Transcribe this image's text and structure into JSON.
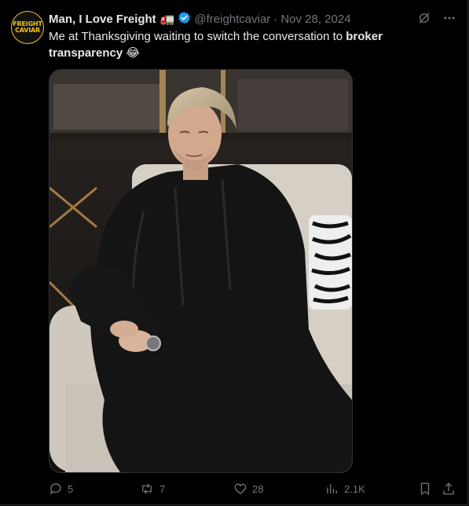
{
  "tweet": {
    "author_name": "Man, I Love Freight",
    "author_emoji": "🚛",
    "handle": "@freightcaviar",
    "separator": "·",
    "date": "Nov 28, 2024",
    "text_plain": "Me at Thanksgiving waiting to switch the conversation to ",
    "text_bold": "broker transparency",
    "text_emoji": "😂"
  },
  "avatar": {
    "line1": "FREIGHT",
    "line2": "CAVIAR"
  },
  "actions": {
    "replies": "5",
    "reposts": "7",
    "likes": "28",
    "views": "2.1K"
  },
  "colors": {
    "background": "#000000",
    "text": "#e7e9ea",
    "muted": "#71767b",
    "verified": "#1d9bf0",
    "brand": "#f2c21b"
  },
  "icons": [
    "grok-icon",
    "more-icon",
    "verified-badge-icon",
    "reply-icon",
    "repost-icon",
    "like-icon",
    "views-icon",
    "bookmark-icon",
    "share-icon"
  ]
}
